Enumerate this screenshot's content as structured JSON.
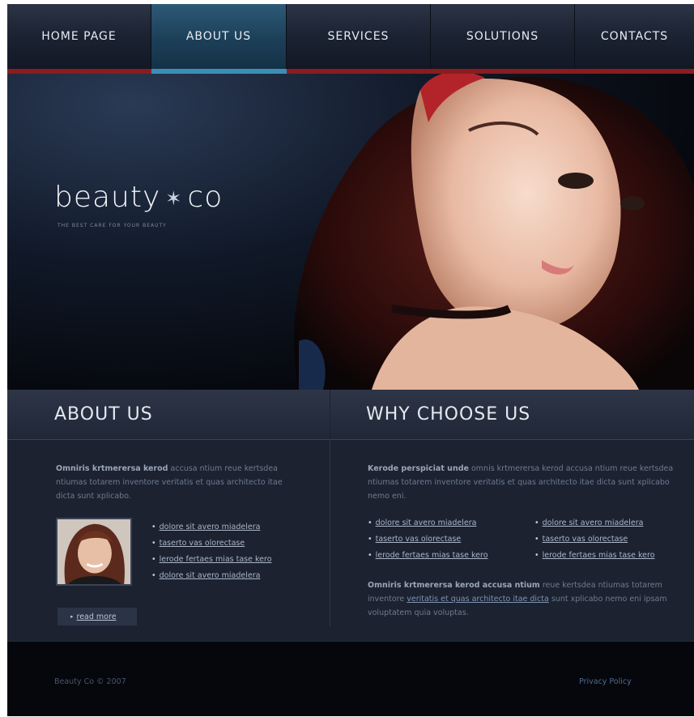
{
  "nav": {
    "items": [
      {
        "label": "HOME PAGE"
      },
      {
        "label": "ABOUT US"
      },
      {
        "label": "SERVICES"
      },
      {
        "label": "SOLUTIONS"
      },
      {
        "label": "CONTACTS"
      }
    ],
    "active_index": 1
  },
  "hero": {
    "logo_left": "beauty",
    "logo_star": "✶",
    "logo_right": "co",
    "tagline": "THE BEST CARE FOR YOUR BEAUTY"
  },
  "about": {
    "title": "ABOUT US",
    "intro_bold": "Omniris krtmerersa kerod",
    "intro_text": " accusa ntium reue kertsdea ntiumas totarem inventore veritatis et quas architecto itae dicta sunt xplicabo.",
    "links": [
      "dolore sit avero miadelera",
      "taserto vas olorectase",
      "lerode fertaes mias tase kero",
      "dolore sit avero miadelera"
    ],
    "read_more": "read more"
  },
  "why": {
    "title": "WHY CHOOSE US",
    "intro_bold": "Kerode perspiciat unde",
    "intro_text": " omnis krtmerersa kerod  accusa ntium reue kertsdea ntiumas totarem inventore veritatis et quas architecto itae dicta sunt xplicabo nemo eni.",
    "links_left": [
      "dolore sit avero miadelera",
      "taserto vas olorectase",
      "lerode fertaes mias tase kero"
    ],
    "links_right": [
      "dolore sit avero miadelera",
      "taserto vas olorectase",
      "lerode fertaes mias tase kero"
    ],
    "outro_bold": "Omniris krtmerersa kerod  accusa ntium",
    "outro_text1": " reue kertsdea ntiumas totarem inventore ",
    "outro_link": "veritatis et quas architecto itae dicta",
    "outro_text2": " sunt xplicabo nemo eni  ipsam voluptatem quia voluptas."
  },
  "footer": {
    "copyright": "Beauty Co © 2007",
    "privacy": "Privacy Policy"
  },
  "colors": {
    "accent_blue": "#3b8fb6",
    "accent_red": "#8a1c1f",
    "panel": "#1c2230"
  },
  "icons": [
    "star-icon",
    "bullet-icon",
    "arrow-right-icon"
  ]
}
